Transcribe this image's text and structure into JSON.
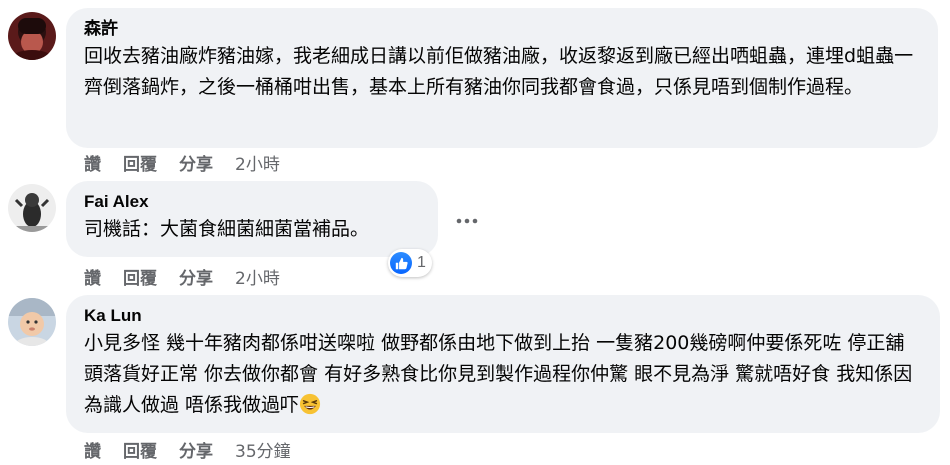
{
  "comments": [
    {
      "author": "森許",
      "text": "回收去豬油廠炸豬油嫁，我老細成日講以前佢做豬油廠，收返黎返到廠已經出哂蛆蟲，連埋d蛆蟲一齊倒落鍋炸，之後一桶桶咁出售，基本上所有豬油你同我都會食過，只係見唔到個制作過程。",
      "actions": {
        "like": "讚",
        "reply": "回覆",
        "share": "分享"
      },
      "time": "2小時"
    },
    {
      "author": "Fai Alex",
      "text": "司機話：大菌食細菌細菌當補品。",
      "actions": {
        "like": "讚",
        "reply": "回覆",
        "share": "分享"
      },
      "time": "2小時",
      "reaction_count": "1",
      "reaction_icon": "like-icon",
      "more_icon": "more-icon"
    },
    {
      "author": "Ka Lun",
      "text": "小見多怪 幾十年豬肉都係咁送㗎啦 做野都係由地下做到上抬 一隻豬200幾磅啊仲要係死咗 停正舖頭落貨好正常 你去做你都會 有好多熟食比你見到製作過程你仲驚 眼不見為淨 驚就唔好食 我知係因為識人做過 唔係我做過吓",
      "emoji": "grinning-squinting-face",
      "actions": {
        "like": "讚",
        "reply": "回覆",
        "share": "分享"
      },
      "time": "35分鐘"
    }
  ],
  "colors": {
    "bubble": "#f0f2f5",
    "secondary_text": "#65676b",
    "like_blue": "#0866ff"
  }
}
